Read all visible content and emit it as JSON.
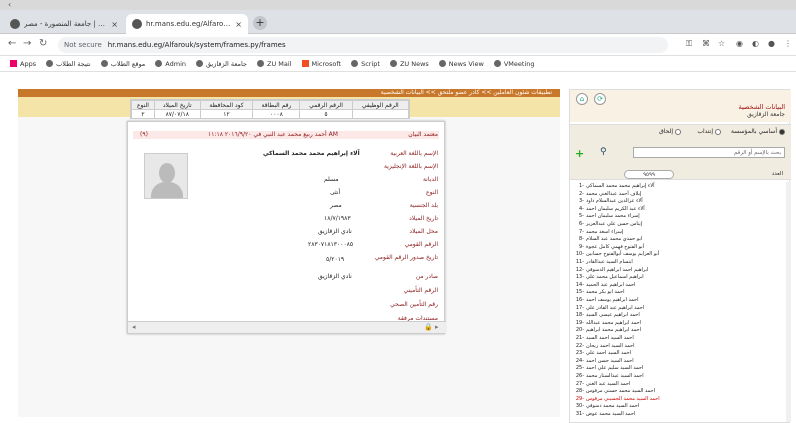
{
  "browser": {
    "tabs": [
      {
        "label": "الصفحة الرئيسية | جامعة المنصورة - مصر",
        "active": false
      },
      {
        "label": "hr.mans.edu.eg/Alfarouk/syste...",
        "active": true
      }
    ],
    "new_tab": "+",
    "address": {
      "not_secure": "Not secure",
      "url": "hr.mans.edu.eg/Alfarouk/system/frames.py/frames"
    },
    "bookmarks": [
      "Apps",
      "نتيجة الطلاب",
      "موقع الطلاب",
      "Admin",
      "جامعة الزقازيق",
      "ZU Mail",
      "Microsoft",
      "Script",
      "ZU News",
      "News View",
      "VMeeting"
    ]
  },
  "main": {
    "breadcrumb": "تطبيقات شئون العاملين >> كادر عضو ملتحق >> البيانات الشخصية",
    "summary": {
      "headers": [
        "الرقم الوظيفي",
        "الرقم الرقمي",
        "رقم البطاقة",
        "كود المحافظة",
        "تاريخ الميلاد",
        "النوع"
      ],
      "values": [
        "",
        "٥",
        "٠٠٠٨",
        "١٢",
        "٨٧/٠٧/١٨",
        "٢"
      ]
    },
    "card": {
      "header_label": "معتمد البيان",
      "header_value": "أحمد ربيع محمد عبد النبي في ٢٠١٦/٩/٢٠ ١١:١٨ AM",
      "header_mark": "(٩)",
      "rows": [
        {
          "label": "الإسم باللغة العربية",
          "value": "آلاء إبراهيم محمد محمد السماكي"
        },
        {
          "label": "الإسم باللغة الإنجليزية",
          "value": ""
        },
        {
          "label": "الديانة",
          "value": "مسلم"
        },
        {
          "label": "النوع",
          "value": "أنثى"
        },
        {
          "label": "بلد الجنسية",
          "value": "مصر"
        },
        {
          "label": "تاريخ الميلاد",
          "value": "١٨/٧/١٩٨٣"
        },
        {
          "label": "محل الميلاد",
          "value": "نادي الزقازيق"
        },
        {
          "label": "الرقم القومي",
          "value": "٢٨٣٠٧١٨١٣٠٠٠٨٥"
        },
        {
          "label": "تاريخ صدور الرقم القومي",
          "value": "٥/٢٠١٩"
        },
        {
          "label": "صادر من",
          "value": "نادي الزقازيق"
        },
        {
          "label": "الرقم التأميني",
          "value": ""
        },
        {
          "label": "رقم التأمين الصحي",
          "value": ""
        },
        {
          "label": "مستندات مرفقة",
          "value": ""
        }
      ]
    }
  },
  "right": {
    "title": "البيانات الشخصية",
    "subtitle": "جامعة الزقازيق",
    "radios": [
      "أساسي بالمؤسسة",
      "إنتداب",
      "إلحاق"
    ],
    "search_placeholder": "بحث بالإسم أو الرقم",
    "count_label": "العدد",
    "count_value": "٩٥٩٩",
    "names": [
      "آلاء إبراهيم محمد محمد السماكي",
      "إيلاف أحمد عبدالغني محمد",
      "آلاء عزالدين عبدالسلام داود",
      "آلاء عبد الكريم سليمان احمد",
      "إسراء محمد سليمان احمد",
      "إيناس حسن علي عبدالعزيز",
      "إسراء اسعد محمد",
      "ابو حمدي محمد عبد السلام",
      "أبو الفتوح فهمي كامل عجوة",
      "أبو العزايم يوسف أبوالفتوح حسانين",
      "ابتسام السيد عبدالقادر",
      "ابراهيم احمد ابراهيم الدسوقي",
      "ابراهيم اسماعيل محمد علي",
      "احمد ابراهيم عبد الحميد",
      "احمد ابو بكر محمد",
      "احمد ابراهيم يوسف احمد",
      "احمد ابراهيم عبد القادر علي",
      "احمد ابراهيم عيسى السيد",
      "احمد ابراهيم محمد عبدالله",
      "احمد ابراهيم محمد ابراهيم",
      "احمد السيد احمد السيد",
      "احمد السيد احمد ريحان",
      "احمد السيد احمد علي",
      "احمد السيد حسن احمد",
      "احمد السيد سليم علي احمد",
      "احمد السيد عبدالستار محمد",
      "احمد السيد عبد الغني",
      "احمد السيد محمد حسني مرقوس",
      "احمد السيد محمد الحسيني مرقوس",
      "احمد السيد محمد دسوقي",
      "احمد السيد محمد عوض"
    ]
  }
}
